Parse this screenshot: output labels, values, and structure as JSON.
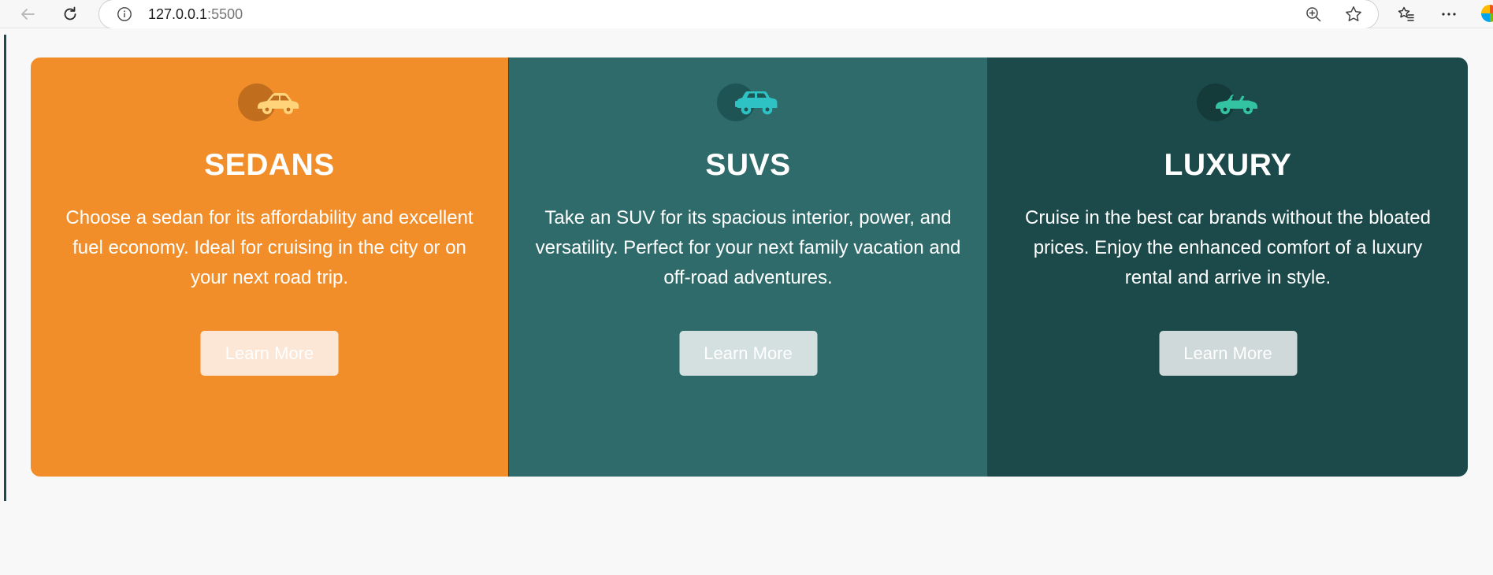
{
  "browser": {
    "url_host": "127.0.0.1",
    "url_port": ":5500",
    "icons": {
      "back": "arrow-left-icon",
      "reload": "reload-icon",
      "site_info": "info-circle-icon",
      "zoom": "zoom-in-icon",
      "favorite": "star-icon",
      "favorites_list": "favorites-icon",
      "more": "more-icon",
      "profile": "edge-logo-icon"
    }
  },
  "cards": [
    {
      "title": "SEDANS",
      "description": "Choose a sedan for its affordability and excellent fuel economy. Ideal for cruising in the city or on your next road trip.",
      "button_label": "Learn More",
      "icon": "sedan-car-icon",
      "background": "#f28e2a",
      "icon_color": "#ffd37a",
      "circle_color": "#c06d1e",
      "button_color": "#fce6d6",
      "button_text_color": "#ffffff"
    },
    {
      "title": "SUVS",
      "description": "Take an SUV for its spacious interior, power, and versatility. Perfect for your next family vacation and off-road adventures.",
      "button_label": "Learn More",
      "icon": "suv-car-icon",
      "background": "#2e6b6a",
      "icon_color": "#2fc2c5",
      "circle_color": "#1f5454",
      "button_color": "#d4e0e0",
      "button_text_color": "#ffffff"
    },
    {
      "title": "LUXURY",
      "description": "Cruise in the best car brands without the bloated prices. Enjoy the enhanced comfort of a luxury rental and arrive in style.",
      "button_label": "Learn More",
      "icon": "convertible-car-icon",
      "background": "#1c4a4a",
      "icon_color": "#33c3a2",
      "circle_color": "#143a3a",
      "button_color": "#cfd9d9",
      "button_text_color": "#ffffff"
    }
  ]
}
